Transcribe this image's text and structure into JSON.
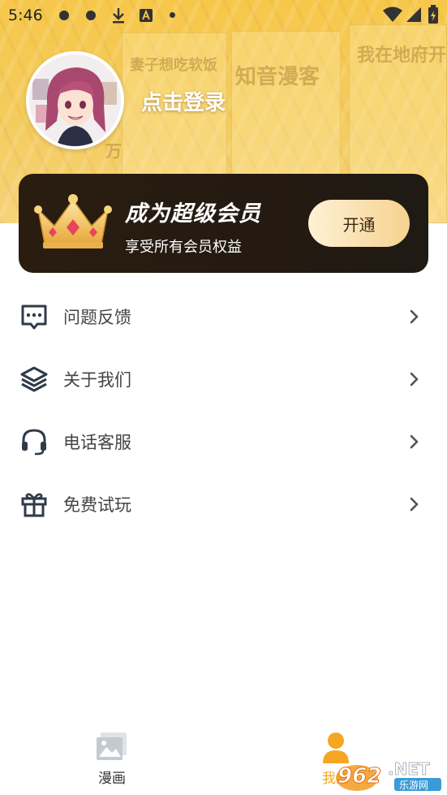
{
  "status_bar": {
    "time": "5:46",
    "icons": [
      "notification-dot-icon",
      "notification-dot-icon",
      "download-icon",
      "a-badge-icon",
      "dot-icon",
      "wifi-icon",
      "signal-icon",
      "battery-icon"
    ]
  },
  "header": {
    "background_texts": [
      "我在地府开后宫",
      "知音漫客",
      "妻子想吃软饭",
      "万"
    ],
    "colors": {
      "banner": "#f6c74a",
      "login_text": "#ffffff"
    }
  },
  "profile": {
    "login_label": "点击登录"
  },
  "vip": {
    "title": "成为超级会员",
    "subtitle": "享受所有会员权益",
    "button_label": "开通",
    "colors": {
      "card": "#241a11",
      "button_start": "#fff1d6",
      "button_end": "#f6d28e"
    }
  },
  "menu": {
    "items": [
      {
        "label": "问题反馈",
        "icon": "chat-bubble-icon"
      },
      {
        "label": "关于我们",
        "icon": "layers-icon"
      },
      {
        "label": "电话客服",
        "icon": "headset-icon"
      },
      {
        "label": "免费试玩",
        "icon": "gift-icon"
      }
    ]
  },
  "bottom_nav": {
    "tabs": [
      {
        "label": "漫画",
        "icon": "gallery-icon",
        "active": false
      },
      {
        "label": "我的",
        "icon": "person-icon",
        "active": true
      }
    ],
    "colors": {
      "active": "#f5a623",
      "inactive": "#333333"
    }
  },
  "watermark": {
    "text": "962.NET",
    "subtext": "乐游网"
  }
}
